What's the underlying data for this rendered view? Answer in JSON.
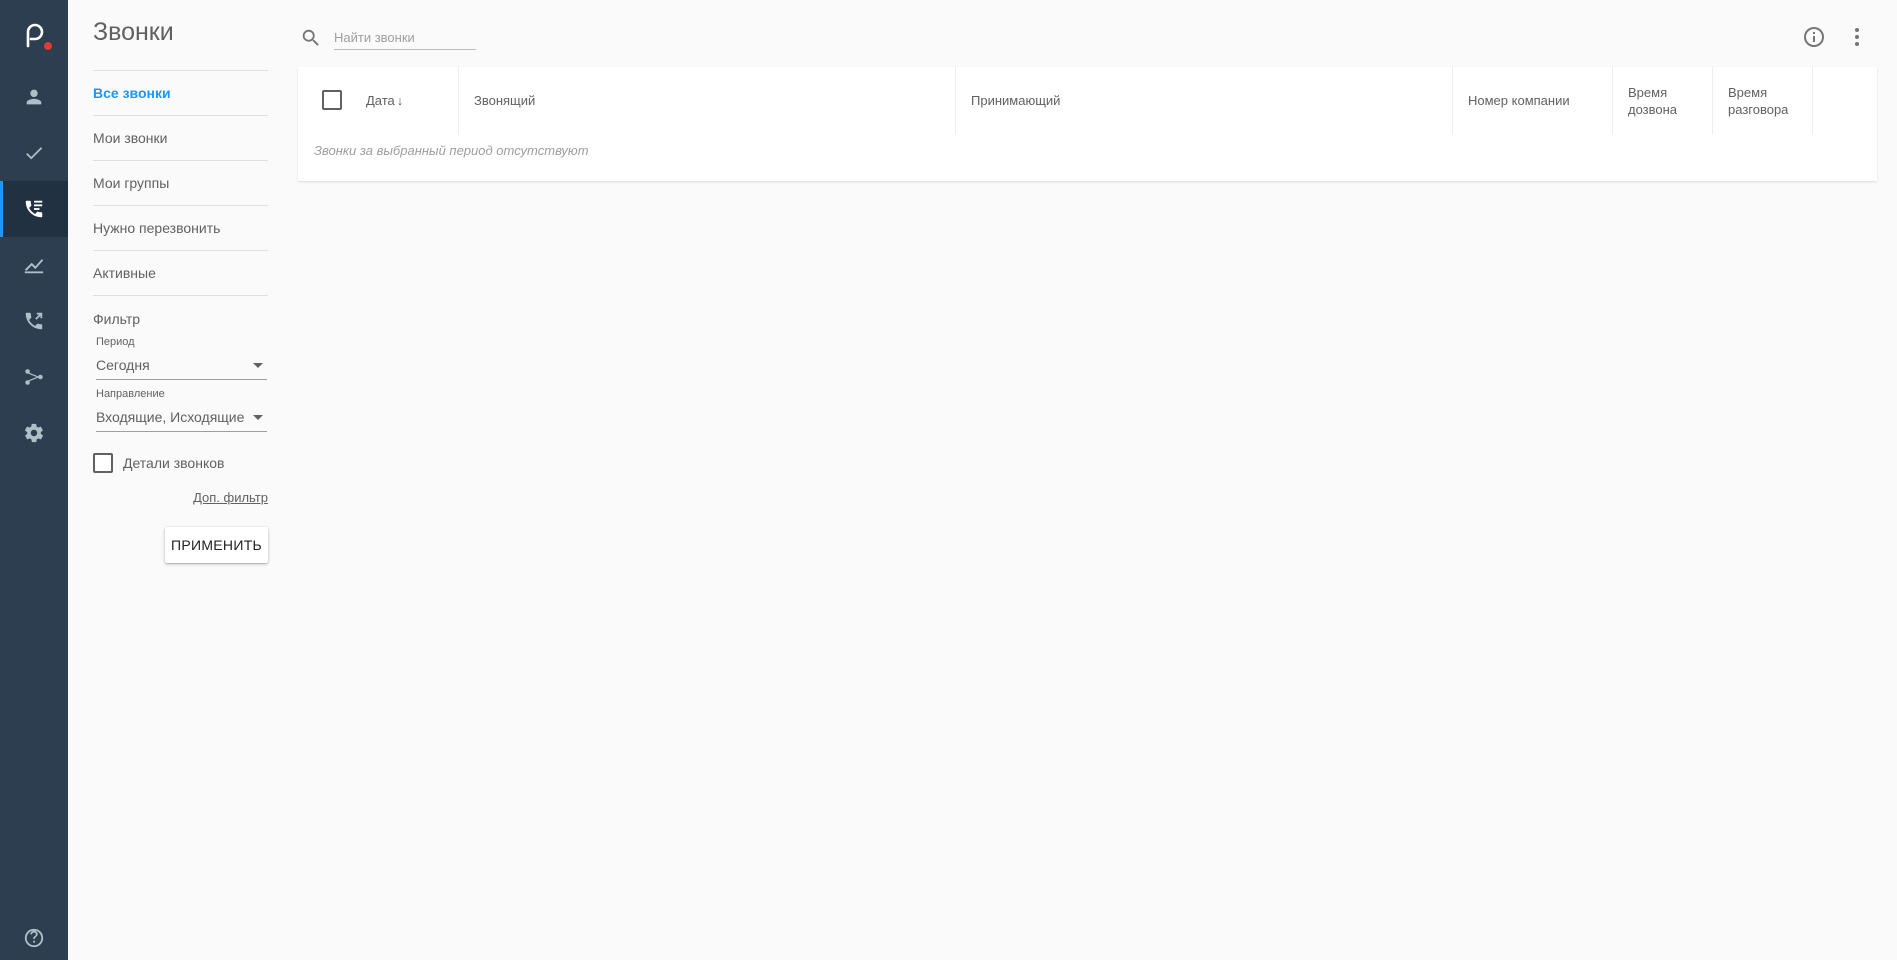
{
  "app": {
    "accent_color": "#2196f3",
    "rail_color": "#2c3e50",
    "logo_dot_color": "#e53935"
  },
  "rail": {
    "items": [
      {
        "icon": "person-icon",
        "active": false
      },
      {
        "icon": "checkmark-icon",
        "active": false
      },
      {
        "icon": "call-list-icon",
        "active": true
      },
      {
        "icon": "line-chart-icon",
        "active": false
      },
      {
        "icon": "phone-forward-icon",
        "active": false
      },
      {
        "icon": "flow-icon",
        "active": false
      },
      {
        "icon": "gear-icon",
        "active": false
      }
    ],
    "bottom_icon": "help-icon"
  },
  "page": {
    "title": "Звонки"
  },
  "nav": {
    "items": [
      {
        "label": "Все звонки",
        "active": true
      },
      {
        "label": "Мои звонки",
        "active": false
      },
      {
        "label": "Мои группы",
        "active": false
      },
      {
        "label": "Нужно перезвонить",
        "active": false
      },
      {
        "label": "Активные",
        "active": false
      }
    ]
  },
  "filter": {
    "title": "Фильтр",
    "period_label": "Период",
    "period_value": "Сегодня",
    "direction_label": "Направление",
    "direction_value": "Входящие, Исходящие",
    "details_label": "Детали звонков",
    "details_checked": false,
    "extra_filter_label": "Доп. фильтр",
    "apply_label": "ПРИМЕНИТЬ"
  },
  "search": {
    "placeholder": "Найти звонки",
    "value": ""
  },
  "table": {
    "columns": [
      {
        "label": "Дата",
        "sorted": "desc"
      },
      {
        "label": "Звонящий"
      },
      {
        "label": "Принимающий"
      },
      {
        "label": "Номер компании"
      },
      {
        "label": "Время дозвона"
      },
      {
        "label": "Время разговора"
      }
    ],
    "empty_message": "Звонки за выбранный период отсутствуют",
    "rows": []
  }
}
